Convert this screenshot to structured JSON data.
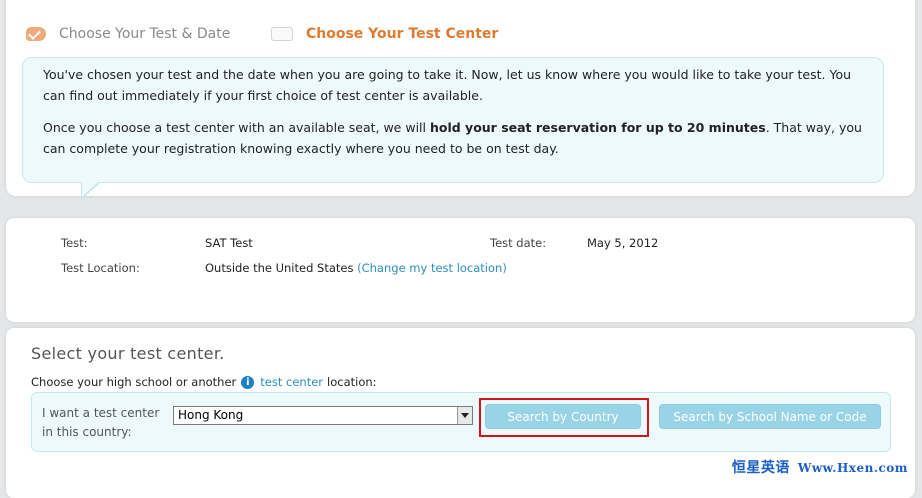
{
  "steps": {
    "step1_label": "Choose Your Test & Date",
    "step2_label": "Choose Your Test Center"
  },
  "intro": {
    "para1": "You've chosen your test and the date when you are going to take it. Now, let us know where you would like to take your test. You can find out immediately if your first choice of test center is available.",
    "para2_pre": "Once you choose a test center with an available seat, we will ",
    "para2_bold": "hold your seat reservation for up to 20 minutes",
    "para2_post": ". That way, you can complete your registration knowing exactly where you need to be on test day."
  },
  "info": {
    "test_label": "Test:",
    "test_value": "SAT Test",
    "date_label": "Test date:",
    "date_value": "May 5, 2012",
    "location_label": "Test Location:",
    "location_value": "Outside the United States",
    "location_link": "(Change my test location)"
  },
  "select": {
    "title": "Select your test center.",
    "sub_pre": "Choose your high school or another",
    "sub_link": "test center",
    "sub_post": "location:",
    "country_label": "I want a test center in this country:",
    "country_value": "Hong Kong",
    "btn_country": "Search by Country",
    "btn_school": "Search by School Name or Code"
  },
  "watermark": {
    "cn": "恒星英语",
    "url": "Www.Hxen.com"
  },
  "colors": {
    "accent_orange": "#e07a2f",
    "button_blue": "#99d3e6",
    "highlight_red": "#d2141b"
  }
}
